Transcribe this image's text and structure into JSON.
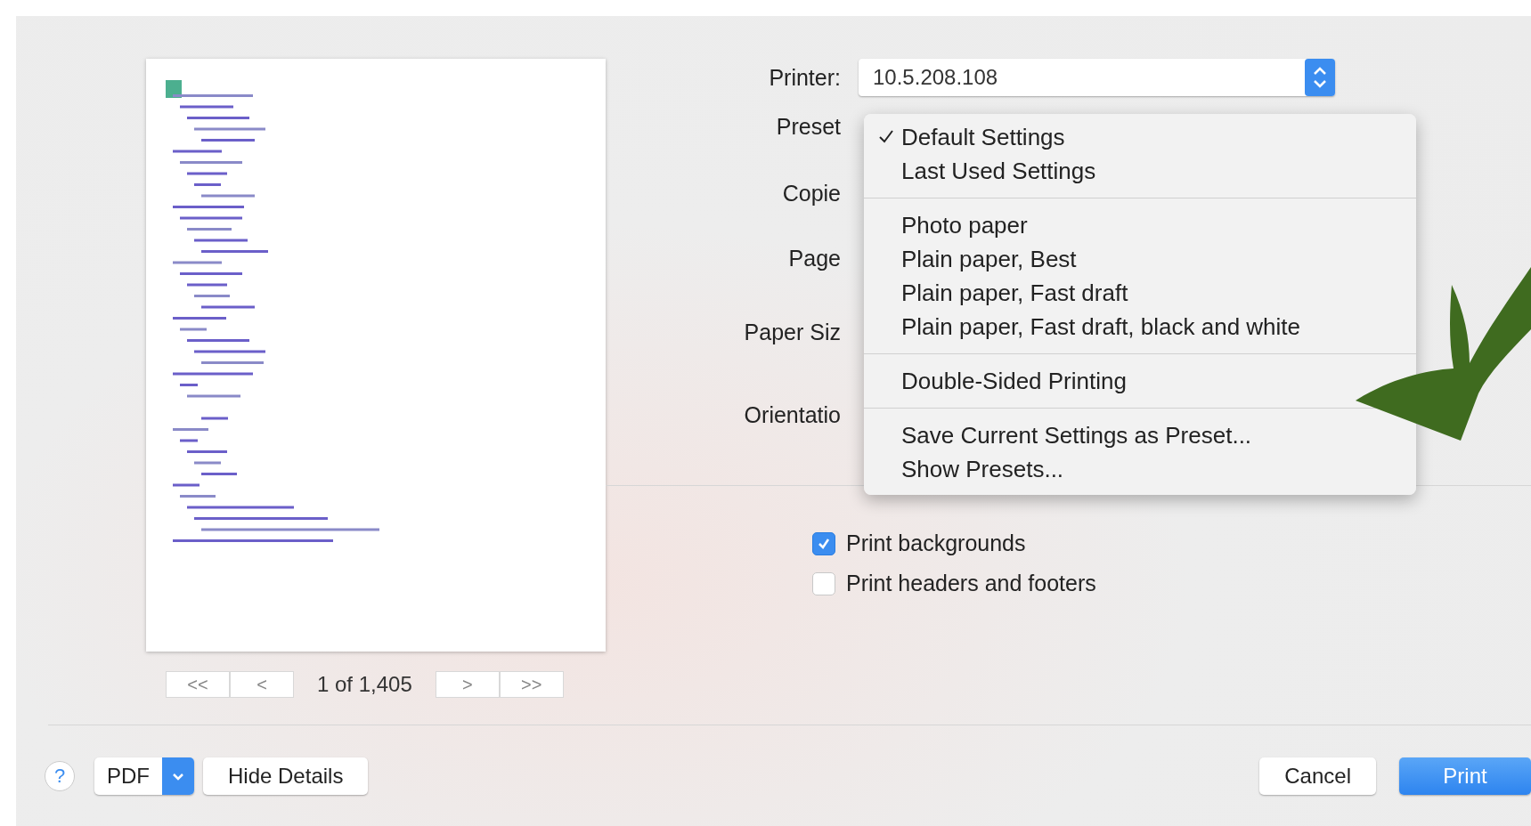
{
  "preview": {
    "nav": {
      "first": "<<",
      "previous": "<",
      "page": "1 of 1,405",
      "next": ">",
      "last": ">>"
    }
  },
  "form": [
    {
      "kind": "popup",
      "label": "Printer:",
      "value": "10.5.208.108"
    },
    {
      "kind": "label",
      "label": "Preset"
    },
    {
      "kind": "label",
      "label": "Copie"
    },
    {
      "kind": "label",
      "label": "Page"
    },
    {
      "kind": "label",
      "label": "Paper Siz"
    },
    {
      "kind": "label",
      "label": "Orientatio"
    }
  ],
  "options": [
    {
      "label": "Print backgrounds",
      "checked": true
    },
    {
      "label": "Print headers and footers",
      "checked": false
    }
  ],
  "presets_menu": [
    {
      "kind": "item",
      "label": "Default Settings",
      "checked": true
    },
    {
      "kind": "item",
      "label": "Last Used Settings",
      "checked": false
    },
    {
      "kind": "separator"
    },
    {
      "kind": "item",
      "label": "Photo paper",
      "checked": false
    },
    {
      "kind": "item",
      "label": "Plain paper, Best",
      "checked": false
    },
    {
      "kind": "item",
      "label": "Plain paper, Fast draft",
      "checked": false
    },
    {
      "kind": "item",
      "label": "Plain paper, Fast draft, black and white",
      "checked": false
    },
    {
      "kind": "separator"
    },
    {
      "kind": "item",
      "label": "Double-Sided Printing",
      "checked": false
    },
    {
      "kind": "separator"
    },
    {
      "kind": "item",
      "label": "Save Current Settings as Preset...",
      "checked": false
    },
    {
      "kind": "item",
      "label": "Show Presets...",
      "checked": false
    }
  ],
  "footer": {
    "help": "?",
    "pdf": "PDF",
    "details": "Hide Details",
    "cancel": "Cancel",
    "print": "Print"
  }
}
